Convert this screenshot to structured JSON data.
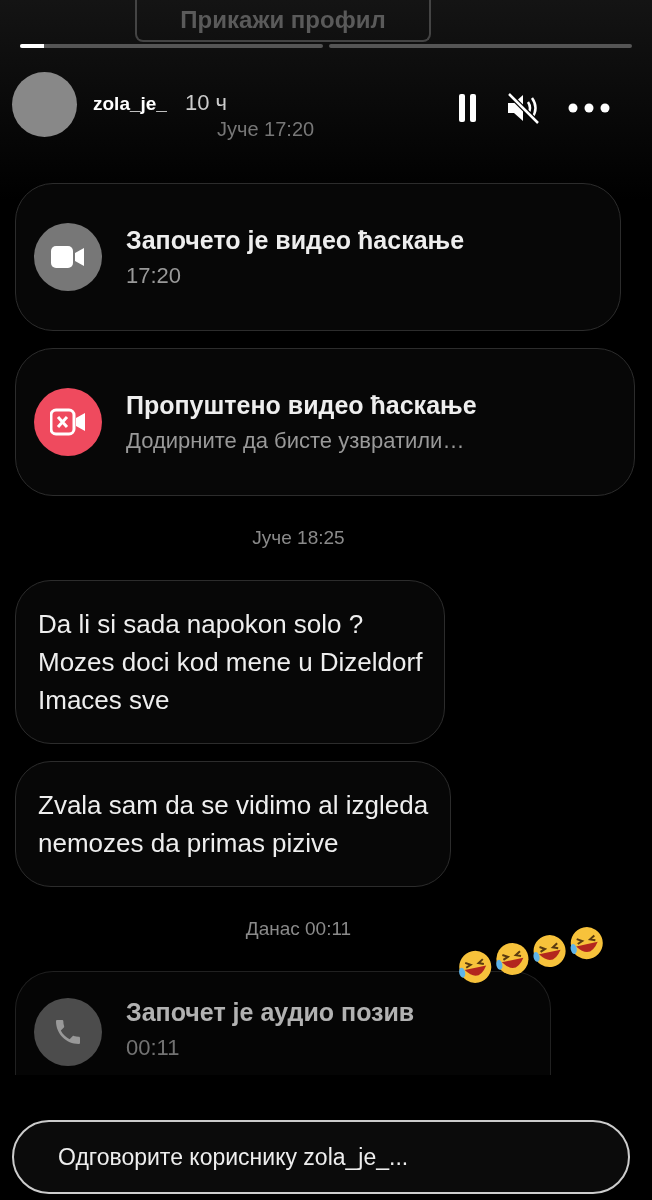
{
  "profile_button": {
    "label": "Прикажи профил"
  },
  "progress": {
    "level": 0.08
  },
  "header": {
    "username": "zola_je_",
    "age": "10 ч",
    "posted": "Јуче 17:20"
  },
  "messages": [
    {
      "kind": "video_call",
      "title": "Започето је видео ћаскање",
      "subtitle": "17:20"
    },
    {
      "kind": "missed_call",
      "title": "Пропуштено видео ћаскање",
      "subtitle": "Додирните да бисте узвратили…"
    },
    {
      "kind": "date",
      "text": "Јуче 18:25"
    },
    {
      "kind": "text",
      "text": "Da li si sada napokon solo ?\nMozes doci kod mene u Dizeldorf\nImaces sve"
    },
    {
      "kind": "text",
      "text": "Zvala sam da se vidimo al izgleda\nnemozes da primas pizive"
    },
    {
      "kind": "date",
      "text": "Данас 00:11"
    },
    {
      "kind": "audio_call",
      "title": "Започет је аудио позив",
      "subtitle": "00:11"
    }
  ],
  "reply": {
    "placeholder": "Одговорите кориснику zola_je_..."
  }
}
